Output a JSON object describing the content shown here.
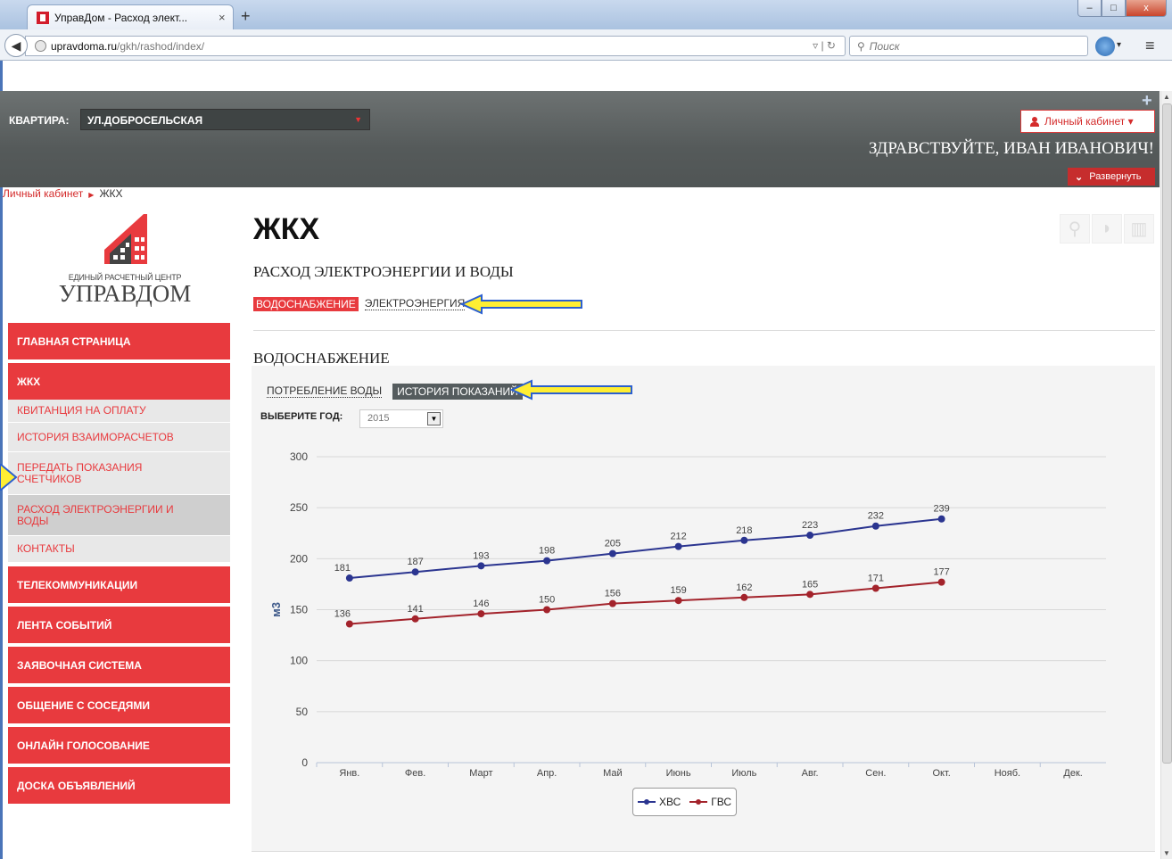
{
  "browser": {
    "tab_title": "УправДом - Расход элект...",
    "tab_close": "×",
    "new_tab": "+",
    "url_domain": "upravdoma.ru",
    "url_path": "/gkh/rashod/index/",
    "search_placeholder": "Поиск",
    "win_min": "–",
    "win_max": "□",
    "win_close": "x"
  },
  "header": {
    "apartment_label": "КВАРТИРА:",
    "apartment_value": "УЛ.ДОБРОСЕЛЬСКАЯ",
    "cabinet_button": "Личный кабинет ▾",
    "greeting": "ЗДРАВСТВУЙТЕ, ИВАН ИВАНОВИЧ!",
    "expand_button": "Развернуть"
  },
  "breadcrumb": {
    "items": [
      "Личный кабинет",
      "ЖКХ"
    ]
  },
  "logo": {
    "small_text": "ЕДИНЫЙ РАСЧЕТНЫЙ ЦЕНТР",
    "big_text": "УПРАВДОМ"
  },
  "sidebar": {
    "items": [
      {
        "label": "ГЛАВНАЯ СТРАНИЦА"
      },
      {
        "label": "ЖКХ"
      },
      {
        "label": "КВИТАНЦИЯ НА ОПЛАТУ"
      },
      {
        "label": "ИСТОРИЯ ВЗАИМОРАСЧЕТОВ"
      },
      {
        "label": "ПЕРЕДАТЬ ПОКАЗАНИЯ СЧЕТЧИКОВ"
      },
      {
        "label": "РАСХОД ЭЛЕКТРОЭНЕРГИИ И ВОДЫ"
      },
      {
        "label": "КОНТАКТЫ"
      },
      {
        "label": "ТЕЛЕКОММУНИКАЦИИ"
      },
      {
        "label": "ЛЕНТА СОБЫТИЙ"
      },
      {
        "label": "ЗАЯВОЧНАЯ СИСТЕМА"
      },
      {
        "label": "ОБЩЕНИЕ С СОСЕДЯМИ"
      },
      {
        "label": "ОНЛАЙН ГОЛОСОВАНИЕ"
      },
      {
        "label": "ДОСКА ОБЪЯВЛЕНИЙ"
      }
    ]
  },
  "main": {
    "title": "ЖКХ",
    "subtitle": "РАСХОД ЭЛЕКТРОЭНЕРГИИ И ВОДЫ",
    "tabs": [
      {
        "label": "ВОДОСНАБЖЕНИЕ"
      },
      {
        "label": "ЭЛЕКТРОЭНЕРГИЯ"
      }
    ],
    "section_title": "ВОДОСНАБЖЕНИЕ",
    "subtabs": [
      {
        "label": "ПОТРЕБЛЕНИЕ ВОДЫ"
      },
      {
        "label": "ИСТОРИЯ ПОКАЗАНИЙ"
      }
    ],
    "year_label": "ВЫБЕРИТЕ ГОД:",
    "year_value": "2015"
  },
  "chart_data": {
    "type": "line",
    "categories": [
      "Янв.",
      "Фев.",
      "Март",
      "Апр.",
      "Май",
      "Июнь",
      "Июль",
      "Авг.",
      "Сен.",
      "Окт.",
      "Нояб.",
      "Дек."
    ],
    "ylabel": "м3",
    "ylim": [
      0,
      300
    ],
    "yticks": [
      0,
      50,
      100,
      150,
      200,
      250,
      300
    ],
    "grid": true,
    "legend": "bottom",
    "series": [
      {
        "name": "ХВС",
        "color": "#2b3590",
        "values": [
          181,
          187,
          193,
          198,
          205,
          212,
          218,
          223,
          232,
          239
        ]
      },
      {
        "name": "ГВС",
        "color": "#a3232b",
        "values": [
          136,
          141,
          146,
          150,
          156,
          159,
          162,
          165,
          171,
          177
        ]
      }
    ]
  }
}
